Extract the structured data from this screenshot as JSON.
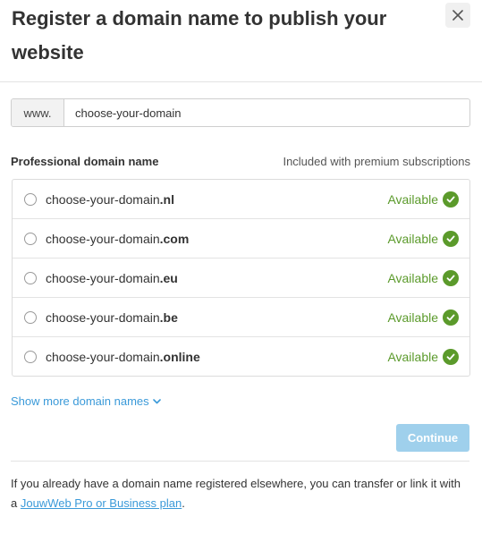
{
  "dialog": {
    "title": "Register a domain name to publish your website",
    "close_icon": "close-icon"
  },
  "domain_input": {
    "prefix": "www.",
    "value": "choose-your-domain"
  },
  "professional": {
    "title": "Professional domain name",
    "note": "Included with premium subscriptions"
  },
  "domains": [
    {
      "base": "choose-your-domain",
      "tld": ".nl",
      "status": "Available",
      "status_icon": "check-circle-icon"
    },
    {
      "base": "choose-your-domain",
      "tld": ".com",
      "status": "Available",
      "status_icon": "check-circle-icon"
    },
    {
      "base": "choose-your-domain",
      "tld": ".eu",
      "status": "Available",
      "status_icon": "check-circle-icon"
    },
    {
      "base": "choose-your-domain",
      "tld": ".be",
      "status": "Available",
      "status_icon": "check-circle-icon"
    },
    {
      "base": "choose-your-domain",
      "tld": ".online",
      "status": "Available",
      "status_icon": "check-circle-icon"
    }
  ],
  "show_more": {
    "label": "Show more domain names",
    "icon": "chevron-down-icon"
  },
  "continue_button": {
    "label": "Continue"
  },
  "footer": {
    "text_before": "If you already have a domain name registered elsewhere, you can transfer or link it with a ",
    "link": "JouwWeb Pro or Business plan",
    "text_after": "."
  },
  "colors": {
    "accent": "#3b9ad9",
    "available": "#5b9a2b",
    "continue_disabled": "#9fd0ec"
  }
}
